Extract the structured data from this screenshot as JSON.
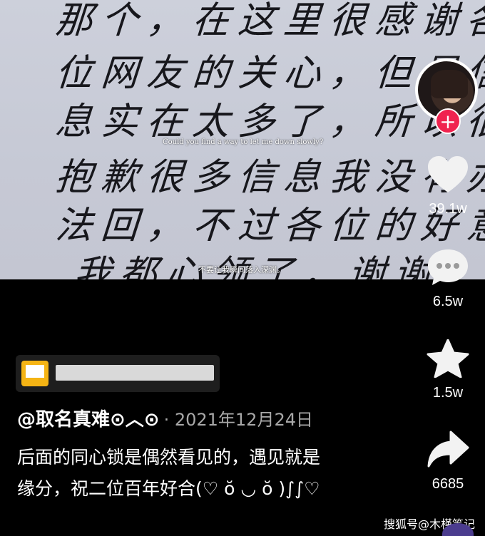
{
  "video": {
    "handwriting_lines": [
      "那个，在这里很感谢各",
      "位网友的关心，但是信",
      "息实在太多了，所以很",
      "抱歉很多信息我没有办",
      "法回，不过各位的好意",
      "我都心领了，谢谢。"
    ],
    "subtitle_en": "Could you find a way to let me down slowly?",
    "subtitle_cn": "不要让我瞬间落入深渊。"
  },
  "actions": {
    "follow_icon": "plus-icon",
    "like": {
      "icon": "heart-icon",
      "count": "39.1w"
    },
    "comment": {
      "icon": "comment-bubble-icon",
      "count": "6.5w"
    },
    "favorite": {
      "icon": "star-icon",
      "count": "1.5w"
    },
    "share": {
      "icon": "share-arrow-icon",
      "count": "6685"
    }
  },
  "info": {
    "author": "@取名真难⊙︿⊙",
    "date": "· 2021年12月24日",
    "caption": "后面的同心锁是偶然看见的，遇见就是缘分，祝二位百年好合(♡ ŏ ◡ ŏ )∫∫♡"
  },
  "watermark": "搜狐号@木槿笔记",
  "colors": {
    "follow": "#f0234f",
    "link_icon": "#f5b414"
  }
}
